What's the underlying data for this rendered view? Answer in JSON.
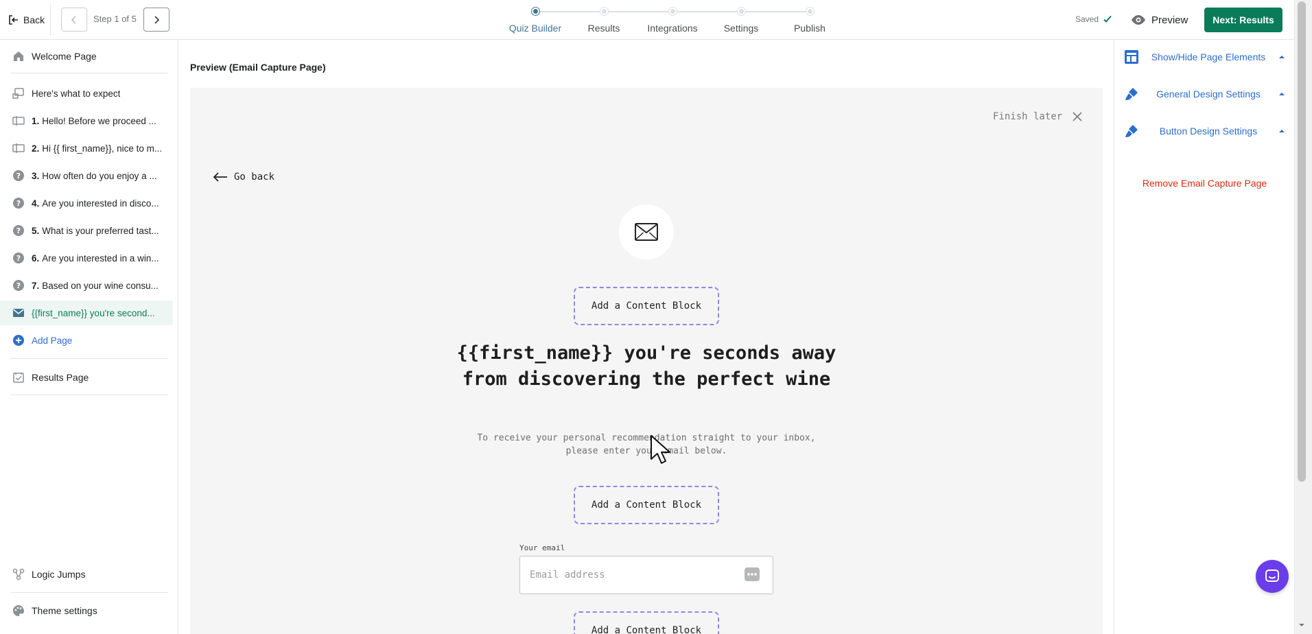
{
  "header": {
    "back_label": "Back",
    "step_label": "Step 1 of 5",
    "steps": [
      {
        "label": "Quiz Builder",
        "active": true
      },
      {
        "label": "Results",
        "active": false
      },
      {
        "label": "Integrations",
        "active": false
      },
      {
        "label": "Settings",
        "active": false
      },
      {
        "label": "Publish",
        "active": false
      }
    ],
    "saved_label": "Saved",
    "preview_label": "Preview",
    "next_label": "Next: Results"
  },
  "sidebar": {
    "welcome_page": "Welcome Page",
    "items": [
      {
        "icon": "intro-icon",
        "num": "",
        "text": "Here's what to expect"
      },
      {
        "icon": "form-icon",
        "num": "1.",
        "text": "Hello! Before we proceed ..."
      },
      {
        "icon": "form-icon",
        "num": "2.",
        "text": "Hi {{ first_name}}, nice to m..."
      },
      {
        "icon": "question-icon",
        "num": "3.",
        "text": "How often do you enjoy a ..."
      },
      {
        "icon": "question-icon",
        "num": "4.",
        "text": "Are you interested in disco..."
      },
      {
        "icon": "question-icon",
        "num": "5.",
        "text": "What is your preferred tast..."
      },
      {
        "icon": "question-icon",
        "num": "6.",
        "text": "Are you interested in a win..."
      },
      {
        "icon": "question-icon",
        "num": "7.",
        "text": "Based on your wine consu..."
      },
      {
        "icon": "mail-icon",
        "num": "",
        "text": "{{first_name}} you're second..."
      }
    ],
    "add_page": "Add Page",
    "results_page": "Results Page",
    "logic_jumps": "Logic Jumps",
    "theme_settings": "Theme settings"
  },
  "main": {
    "title": "Preview (Email Capture Page)",
    "finish_later": "Finish later",
    "go_back": "Go back",
    "content_block_label": "Add a Content Block",
    "headline": "{{first_name}} you're seconds away from discovering the perfect wine",
    "subtext": "To receive your personal recommendation straight to your inbox, please enter your email below.",
    "email_label": "Your email",
    "email_placeholder": "Email address"
  },
  "right_panel": {
    "items": [
      {
        "icon": "layout-icon",
        "label": "Show/Hide Page Elements"
      },
      {
        "icon": "brush-icon",
        "label": "General Design Settings"
      },
      {
        "icon": "brush-icon",
        "label": "Button Design Settings"
      }
    ],
    "remove_label": "Remove Email Capture Page"
  },
  "colors": {
    "accent_green": "#0a7c5a",
    "link_blue": "#2c6ecb",
    "stepper_active": "#42748f",
    "danger_red": "#d72c0d",
    "dashed_border": "#8a88e8",
    "chat_purple": "#6a3de8"
  }
}
